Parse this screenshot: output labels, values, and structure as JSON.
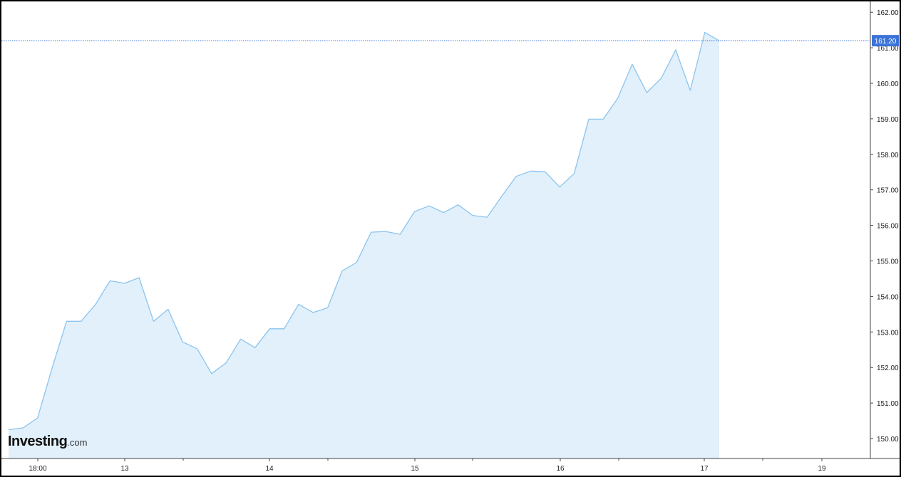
{
  "chart_data": {
    "type": "area",
    "title": "",
    "xlabel": "",
    "ylabel": "",
    "ylim": [
      149.6,
      162.3
    ],
    "grid": false,
    "y_ticks": [
      "150.00",
      "151.00",
      "152.00",
      "153.00",
      "154.00",
      "155.00",
      "156.00",
      "157.00",
      "158.00",
      "159.00",
      "160.00",
      "161.00",
      "162.00"
    ],
    "x_ticks": [
      "18:00",
      "13",
      "14",
      "15",
      "16",
      "17",
      "19"
    ],
    "current_price": "161.20",
    "colors": {
      "line": "#8cc4ee",
      "fill": "#e1f0fa",
      "price_tag": "#3c73d8",
      "crosshair": "#3c73d8"
    },
    "series": [
      {
        "values": [
          150.25,
          150.3,
          150.58,
          151.98,
          153.3,
          153.3,
          153.78,
          154.44,
          154.37,
          154.53,
          153.3,
          153.64,
          152.72,
          152.53,
          151.83,
          152.13,
          152.8,
          152.56,
          153.09,
          153.09,
          153.78,
          153.55,
          153.68,
          154.72,
          154.96,
          155.81,
          155.83,
          155.75,
          156.39,
          156.55,
          156.36,
          156.58,
          156.28,
          156.23,
          156.82,
          157.38,
          157.53,
          157.51,
          157.08,
          157.46,
          158.99,
          158.99,
          159.58,
          160.54,
          159.74,
          160.14,
          160.94,
          159.8,
          161.43,
          161.2
        ]
      }
    ]
  },
  "branding": {
    "logo_main": "Investing",
    "logo_suffix": ".com"
  }
}
